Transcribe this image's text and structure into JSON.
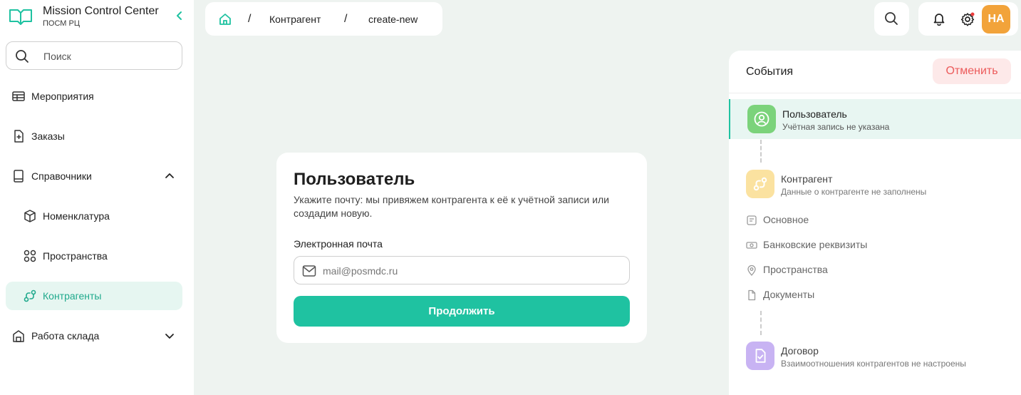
{
  "app": {
    "title": "Mission Control Center",
    "subtitle": "ПОСМ РЦ"
  },
  "sidebar": {
    "search_placeholder": "Поиск",
    "items": [
      {
        "label": "Мероприятия",
        "icon": "events-icon"
      },
      {
        "label": "Заказы",
        "icon": "orders-icon"
      },
      {
        "label": "Справочники",
        "icon": "book-icon",
        "expanded": true
      },
      {
        "label": "Номенклатура",
        "icon": "box-icon"
      },
      {
        "label": "Пространства",
        "icon": "grid-icon"
      },
      {
        "label": "Контрагенты",
        "icon": "counterparty-icon",
        "active": true
      },
      {
        "label": "Работа склада",
        "icon": "warehouse-icon",
        "expanded": false
      }
    ]
  },
  "breadcrumb": {
    "items": [
      "Контрагент",
      "create-new"
    ],
    "separator": "/"
  },
  "user": {
    "initials": "НА"
  },
  "form": {
    "title": "Пользователь",
    "description": "Укажите почту: мы привяжем контрагента к её к учётной записи или создадим новую.",
    "email_label": "Электронная почта",
    "email_placeholder": "mail@posmdc.ru",
    "email_value": "",
    "submit_label": "Продолжить"
  },
  "events": {
    "title": "События",
    "cancel_label": "Отменить",
    "steps": [
      {
        "title": "Пользователь",
        "subtitle": "Учётная запись не указана",
        "active": true,
        "color": "#7bd37b"
      },
      {
        "title": "Контрагент",
        "subtitle": "Данные о контрагенте не заполнены",
        "active": false,
        "color": "#fbe2a0"
      },
      {
        "title": "Договор",
        "subtitle": "Взаимоотношения контрагентов не настроены",
        "active": false,
        "color": "#c8b3f3"
      }
    ],
    "substeps": [
      "Основное",
      "Банковские реквизиты",
      "Пространства",
      "Документы"
    ]
  },
  "colors": {
    "accent": "#1fc2a1",
    "cancel_bg": "#fde9e9",
    "cancel_text": "#ec5b5b",
    "avatar_bg": "#f2a33a"
  }
}
